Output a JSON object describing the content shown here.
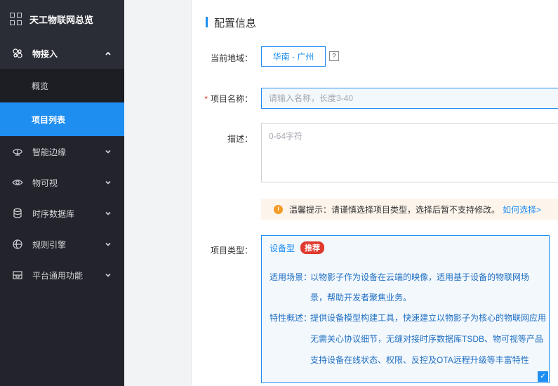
{
  "sidebar": {
    "top_title": "天工物联网总览",
    "group": {
      "label": "物接入"
    },
    "sub_items": [
      {
        "label": "概览",
        "active": false
      },
      {
        "label": "项目列表",
        "active": true
      }
    ],
    "items": [
      {
        "label": "智能边缘",
        "icon": "edge-icon"
      },
      {
        "label": "物可视",
        "icon": "eye-icon"
      },
      {
        "label": "时序数据库",
        "icon": "database-icon"
      },
      {
        "label": "规则引擎",
        "icon": "rule-engine-icon"
      },
      {
        "label": "平台通用功能",
        "icon": "platform-icon"
      }
    ]
  },
  "form": {
    "section_title": "配置信息",
    "region_label": "当前地域：",
    "region_value": "华南 - 广州",
    "help_glyph": "?",
    "name_required_mark": "*",
    "name_label": "项目名称：",
    "name_placeholder": "请输入名称，长度3-40",
    "desc_label": "描述：",
    "desc_placeholder": "0-64字符",
    "tip_text": "温馨提示：请谨慎选择项目类型，选择后暂不支持修改。",
    "tip_link": "如何选择>",
    "type_label": "项目类型：",
    "type_card": {
      "name": "设备型",
      "badge": "推荐",
      "scene_key": "适用场景：",
      "scene_line1": "以物影子作为设备在云端的映像，适用基于设备的物联网场",
      "scene_line2": "景，帮助开发者聚焦业务。",
      "feature_key": "特性概述：",
      "feature_line1": "提供设备模型构建工具，快速建立以物影子为核心的物联网应用",
      "feature_line2": "无需关心协议细节，无缝对接时序数据库TSDB、物可视等产品",
      "feature_line3": "支持设备在线状态、权限、反控及OTA远程升级等丰富特性"
    }
  },
  "colors": {
    "accent": "#1f8ef1",
    "sidebar_bg": "#22232b",
    "badge_red": "#e03a2e",
    "tip_bg": "#fdf5ec"
  }
}
